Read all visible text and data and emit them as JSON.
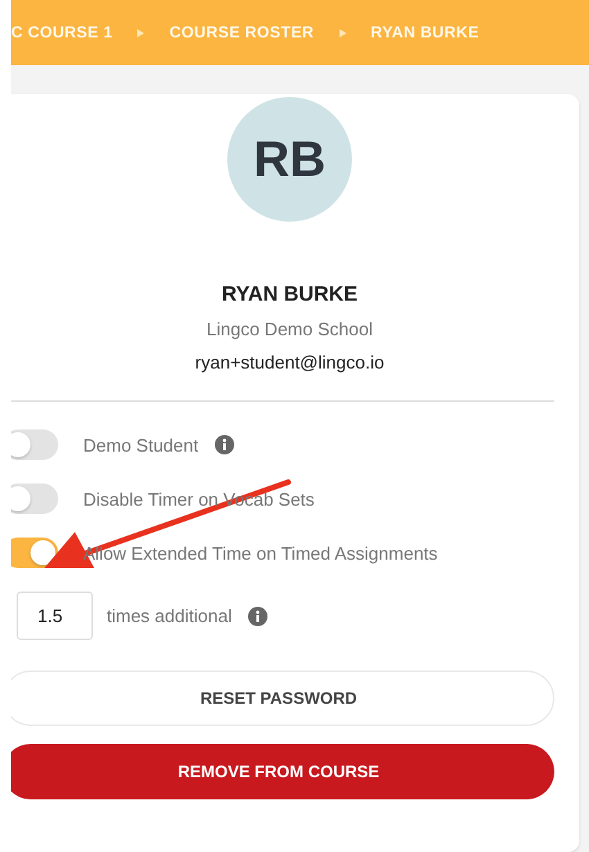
{
  "breadcrumbs": [
    {
      "label": "C COURSE 1"
    },
    {
      "label": "COURSE ROSTER"
    },
    {
      "label": "RYAN BURKE"
    }
  ],
  "profile": {
    "initials": "RB",
    "name": "RYAN BURKE",
    "school": "Lingco Demo School",
    "email": "ryan+student@lingco.io"
  },
  "settings": [
    {
      "label": "Demo Student",
      "on": false,
      "info": true
    },
    {
      "label": "Disable Timer on Vocab Sets",
      "on": false,
      "info": false
    },
    {
      "label": "Allow Extended Time on Timed Assignments",
      "on": true,
      "info": false
    }
  ],
  "extended_time": {
    "value": "1.5",
    "label": "times additional",
    "info": true
  },
  "buttons": [
    {
      "label": "RESET PASSWORD",
      "kind": "secondary"
    },
    {
      "label": "REMOVE FROM COURSE",
      "kind": "danger"
    }
  ]
}
